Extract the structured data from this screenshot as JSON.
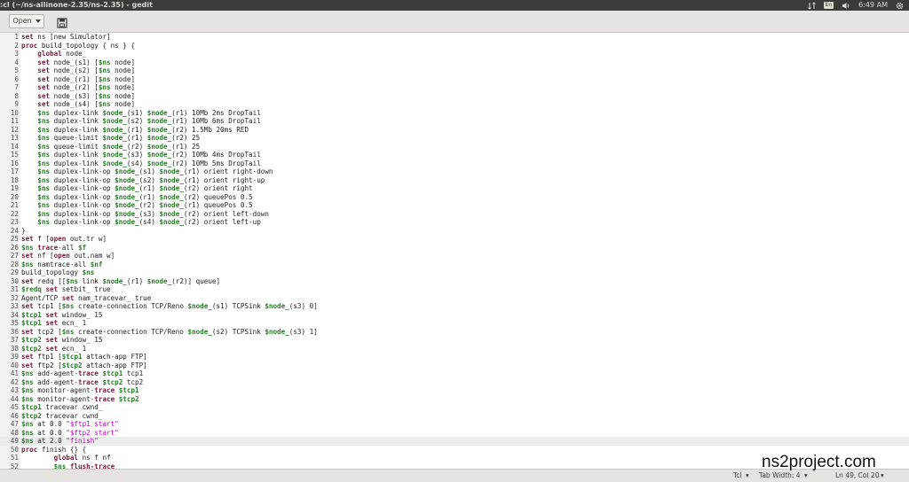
{
  "window": {
    "title": ":cl (~/ns-allinone-2.35/ns-2.35) - gedit"
  },
  "tray": {
    "keyboard_layout": "En",
    "time": "6:49 AM"
  },
  "toolbar": {
    "open_label": "Open"
  },
  "editor": {
    "current_line": 49,
    "lines": [
      {
        "n": "1",
        "code": "<span class='kw'>set</span> ns [new Simulator]"
      },
      {
        "n": "2",
        "code": "<span class='kw'>proc</span> build_topology { ns } {"
      },
      {
        "n": "3",
        "code": "    <span class='kw'>global</span> node_"
      },
      {
        "n": "4",
        "code": "    <span class='kw'>set</span> node_(s1) [<span class='var'>$ns</span> node]"
      },
      {
        "n": "5",
        "code": "    <span class='kw'>set</span> node_(s2) [<span class='var'>$ns</span> node]"
      },
      {
        "n": "6",
        "code": "    <span class='kw'>set</span> node_(r1) [<span class='var'>$ns</span> node]"
      },
      {
        "n": "7",
        "code": "    <span class='kw'>set</span> node_(r2) [<span class='var'>$ns</span> node]"
      },
      {
        "n": "8",
        "code": "    <span class='kw'>set</span> node_(s3) [<span class='var'>$ns</span> node]"
      },
      {
        "n": "9",
        "code": "    <span class='kw'>set</span> node_(s4) [<span class='var'>$ns</span> node]"
      },
      {
        "n": "10",
        "code": "    <span class='var'>$ns</span> duplex-link <span class='var'>$node_</span>(s1) <span class='var'>$node_</span>(r1) 10Mb 2ms DropTail"
      },
      {
        "n": "11",
        "code": "    <span class='var'>$ns</span> duplex-link <span class='var'>$node_</span>(s2) <span class='var'>$node_</span>(r1) 10Mb 6ms DropTail"
      },
      {
        "n": "12",
        "code": "    <span class='var'>$ns</span> duplex-link <span class='var'>$node_</span>(r1) <span class='var'>$node_</span>(r2) 1.5Mb 20ms RED"
      },
      {
        "n": "13",
        "code": "    <span class='var'>$ns</span> queue-limit <span class='var'>$node_</span>(r1) <span class='var'>$node_</span>(r2) 25"
      },
      {
        "n": "14",
        "code": "    <span class='var'>$ns</span> queue-limit <span class='var'>$node_</span>(r2) <span class='var'>$node_</span>(r1) 25"
      },
      {
        "n": "15",
        "code": "    <span class='var'>$ns</span> duplex-link <span class='var'>$node_</span>(s3) <span class='var'>$node_</span>(r2) 10Mb 4ms DropTail"
      },
      {
        "n": "16",
        "code": "    <span class='var'>$ns</span> duplex-link <span class='var'>$node_</span>(s4) <span class='var'>$node_</span>(r2) 10Mb 5ms DropTail"
      },
      {
        "n": "17",
        "code": "    <span class='var'>$ns</span> duplex-link-op <span class='var'>$node_</span>(s1) <span class='var'>$node_</span>(r1) orient right-down"
      },
      {
        "n": "18",
        "code": "    <span class='var'>$ns</span> duplex-link-op <span class='var'>$node_</span>(s2) <span class='var'>$node_</span>(r1) orient right-up"
      },
      {
        "n": "19",
        "code": "    <span class='var'>$ns</span> duplex-link-op <span class='var'>$node_</span>(r1) <span class='var'>$node_</span>(r2) orient right"
      },
      {
        "n": "20",
        "code": "    <span class='var'>$ns</span> duplex-link-op <span class='var'>$node_</span>(r1) <span class='var'>$node_</span>(r2) queuePos 0.5"
      },
      {
        "n": "21",
        "code": "    <span class='var'>$ns</span> duplex-link-op <span class='var'>$node_</span>(r2) <span class='var'>$node_</span>(r1) queuePos 0.5"
      },
      {
        "n": "22",
        "code": "    <span class='var'>$ns</span> duplex-link-op <span class='var'>$node_</span>(s3) <span class='var'>$node_</span>(r2) orient left-down"
      },
      {
        "n": "23",
        "code": "    <span class='var'>$ns</span> duplex-link-op <span class='var'>$node_</span>(s4) <span class='var'>$node_</span>(r2) orient left-up"
      },
      {
        "n": "24",
        "code": "}"
      },
      {
        "n": "25",
        "code": "<span class='kw'>set</span> f [<span class='kw'>open</span> out.tr w]"
      },
      {
        "n": "26",
        "code": "<span class='var'>$ns</span> <span class='kw'>trace</span>-all <span class='var'>$f</span>"
      },
      {
        "n": "27",
        "code": "<span class='kw'>set</span> nf [<span class='kw'>open</span> out.nam w]"
      },
      {
        "n": "28",
        "code": "<span class='var'>$ns</span> namtrace-all <span class='var'>$nf</span>"
      },
      {
        "n": "29",
        "code": "build_topology <span class='var'>$ns</span>"
      },
      {
        "n": "30",
        "code": "<span class='kw'>set</span> redq [[<span class='var'>$ns</span> link <span class='var'>$node_</span>(r1) <span class='var'>$node_</span>(r2)] queue]"
      },
      {
        "n": "31",
        "code": "<span class='var'>$redq</span> <span class='kw'>set</span> setbit_ true"
      },
      {
        "n": "32",
        "code": "Agent/TCP <span class='kw'>set</span> nam_tracevar_ true"
      },
      {
        "n": "33",
        "code": "<span class='kw'>set</span> tcp1 [<span class='var'>$ns</span> create-connection TCP/Reno <span class='var'>$node_</span>(s1) TCPSink <span class='var'>$node_</span>(s3) 0]"
      },
      {
        "n": "34",
        "code": "<span class='var'>$tcp1</span> <span class='kw'>set</span> window_ 15"
      },
      {
        "n": "35",
        "code": "<span class='var'>$tcp1</span> <span class='kw'>set</span> ecn_ 1"
      },
      {
        "n": "36",
        "code": "<span class='kw'>set</span> tcp2 [<span class='var'>$ns</span> create-connection TCP/Reno <span class='var'>$node_</span>(s2) TCPSink <span class='var'>$node_</span>(s3) 1]"
      },
      {
        "n": "37",
        "code": "<span class='var'>$tcp2</span> <span class='kw'>set</span> window_ 15"
      },
      {
        "n": "38",
        "code": "<span class='var'>$tcp2</span> <span class='kw'>set</span> ecn_ 1"
      },
      {
        "n": "39",
        "code": "<span class='kw'>set</span> ftp1 [<span class='var'>$tcp1</span> attach-app FTP]"
      },
      {
        "n": "40",
        "code": "<span class='kw'>set</span> ftp2 [<span class='var'>$tcp2</span> attach-app FTP]"
      },
      {
        "n": "41",
        "code": "<span class='var'>$ns</span> add-agent-<span class='kw'>trace</span> <span class='var'>$tcp1</span> tcp1"
      },
      {
        "n": "42",
        "code": "<span class='var'>$ns</span> add-agent-<span class='kw'>trace</span> <span class='var'>$tcp2</span> tcp2"
      },
      {
        "n": "43",
        "code": "<span class='var'>$ns</span> monitor-agent-<span class='kw'>trace</span> <span class='var'>$tcp1</span>"
      },
      {
        "n": "44",
        "code": "<span class='var'>$ns</span> monitor-agent-<span class='kw'>trace</span> <span class='var'>$tcp2</span>"
      },
      {
        "n": "45",
        "code": "<span class='var'>$tcp1</span> tracevar cwnd_"
      },
      {
        "n": "46",
        "code": "<span class='var'>$tcp2</span> tracevar cwnd_"
      },
      {
        "n": "47",
        "code": "<span class='var'>$ns</span> at 0.0 <span class='str'>\"$ftp1 start\"</span>"
      },
      {
        "n": "48",
        "code": "<span class='var'>$ns</span> at 0.0 <span class='str'>\"$ftp2 start\"</span>"
      },
      {
        "n": "49",
        "code": "<span class='var'>$ns</span> at 2.0 <span class='str'>\"finish\"</span>"
      },
      {
        "n": "50",
        "code": "<span class='kw'>proc</span> finish {} {"
      },
      {
        "n": "51",
        "code": "        <span class='kw'>global</span> ns f nf"
      },
      {
        "n": "52",
        "code": "        <span class='var'>$ns</span> <span class='kw'>flush-trace</span>"
      }
    ]
  },
  "statusbar": {
    "language": "Tcl",
    "tab_width": "Tab Width: 4",
    "cursor": "Ln 49, Col 20"
  },
  "watermark": {
    "text": "ns2project.com"
  }
}
